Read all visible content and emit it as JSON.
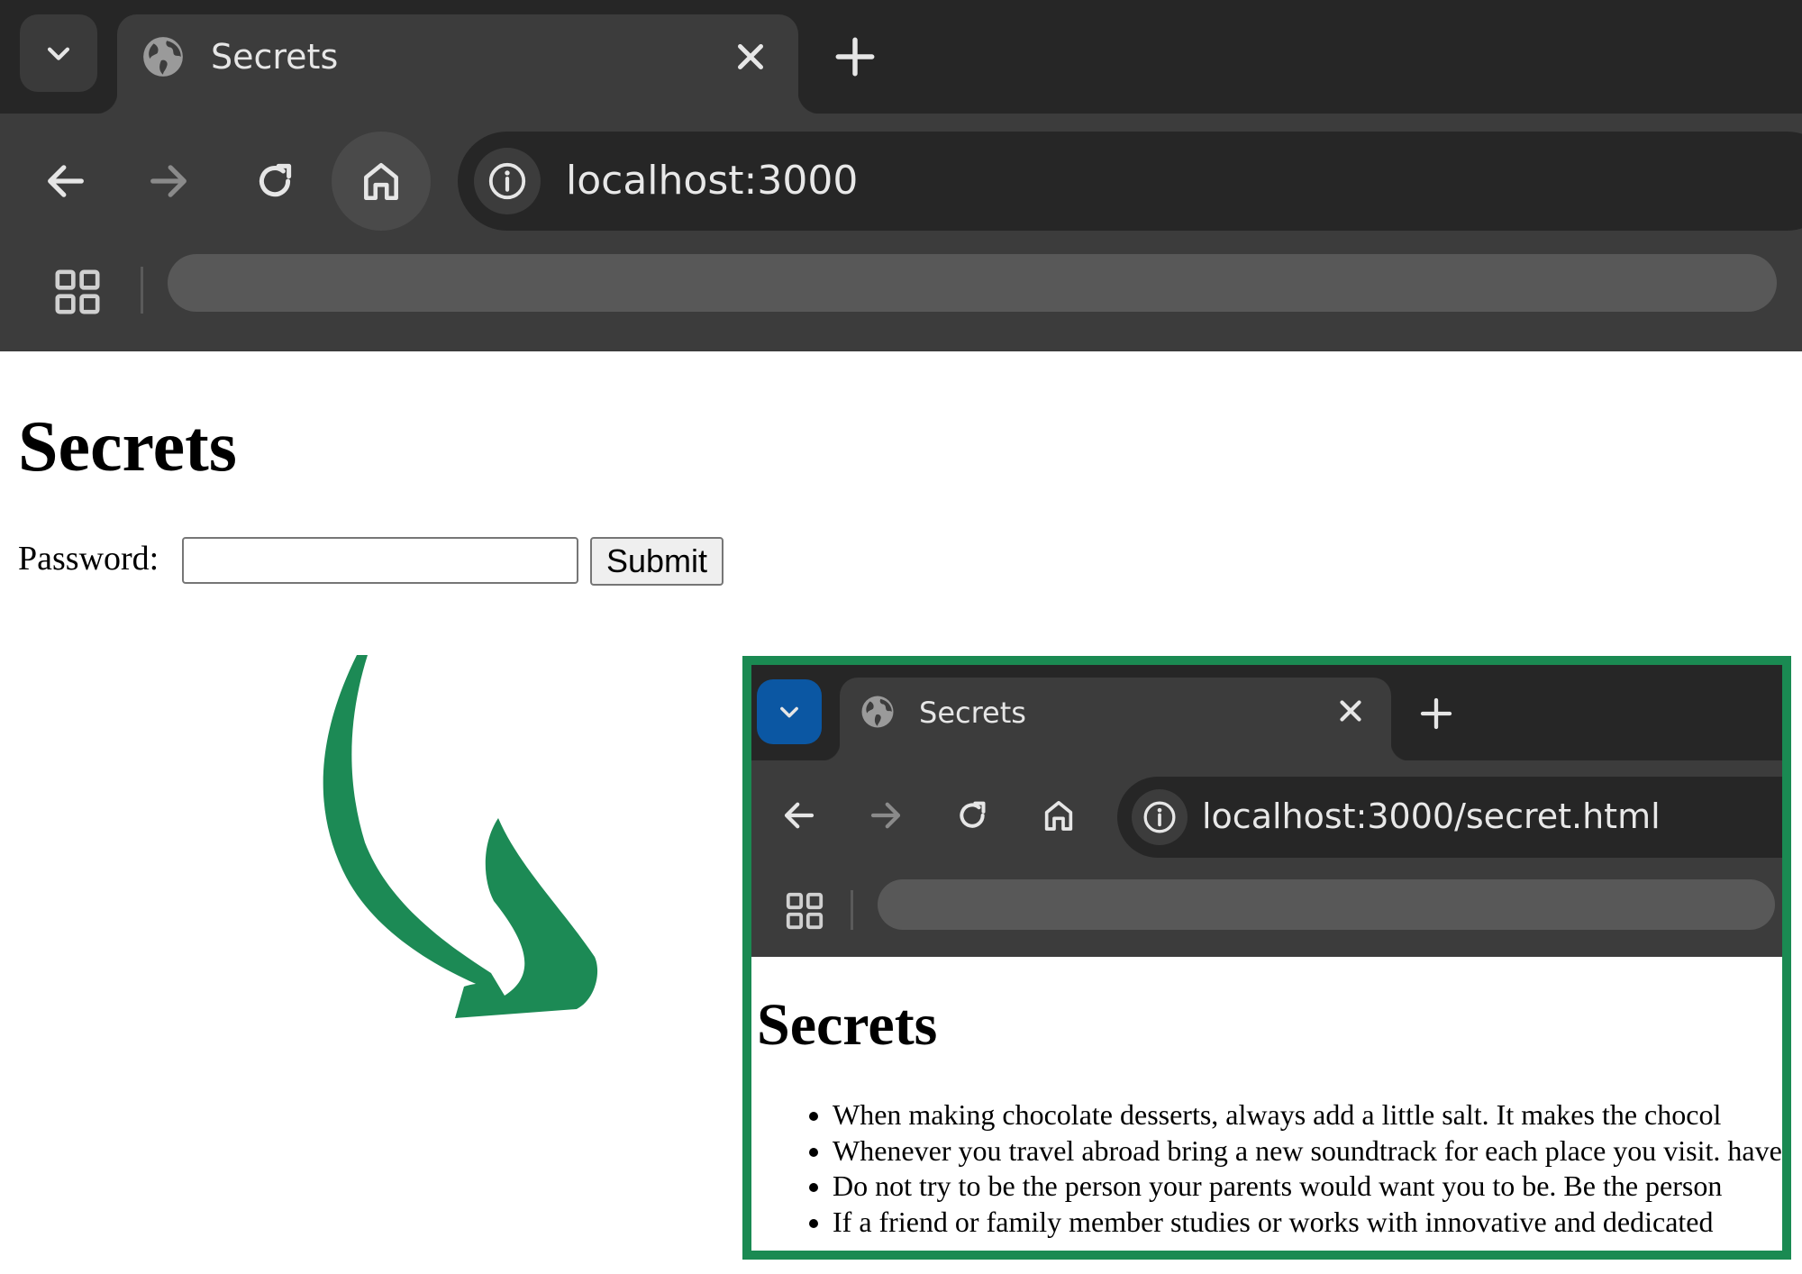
{
  "main_window": {
    "tab": {
      "title": "Secrets"
    },
    "address_bar": {
      "url": "localhost:3000"
    },
    "page": {
      "heading": "Secrets",
      "password_label": "Password:",
      "password_value": "",
      "submit_label": "Submit"
    }
  },
  "inset_window": {
    "tab": {
      "title": "Secrets"
    },
    "address_bar": {
      "url": "localhost:3000/secret.html"
    },
    "page": {
      "heading": "Secrets",
      "items": [
        "When making chocolate desserts, always add a little salt. It makes the chocol",
        "Whenever you travel abroad bring a new soundtrack for each place you visit. have visited.",
        "Do not try to be the person your parents would want you to be. Be the person",
        "If a friend or family member studies or works with innovative and dedicated"
      ]
    }
  },
  "colors": {
    "tabstrip_bg": "#262626",
    "toolbar_bg": "#3c3c3c",
    "arrow_green": "#1c8a55",
    "inset_border": "#1a8a52",
    "inset_tab_dropdown": "#0b57a3"
  },
  "icons": [
    "chevron-down-icon",
    "globe-icon",
    "close-icon",
    "plus-icon",
    "back-arrow-icon",
    "forward-arrow-icon",
    "reload-icon",
    "home-icon",
    "info-icon",
    "apps-grid-icon",
    "curved-arrow-icon"
  ]
}
